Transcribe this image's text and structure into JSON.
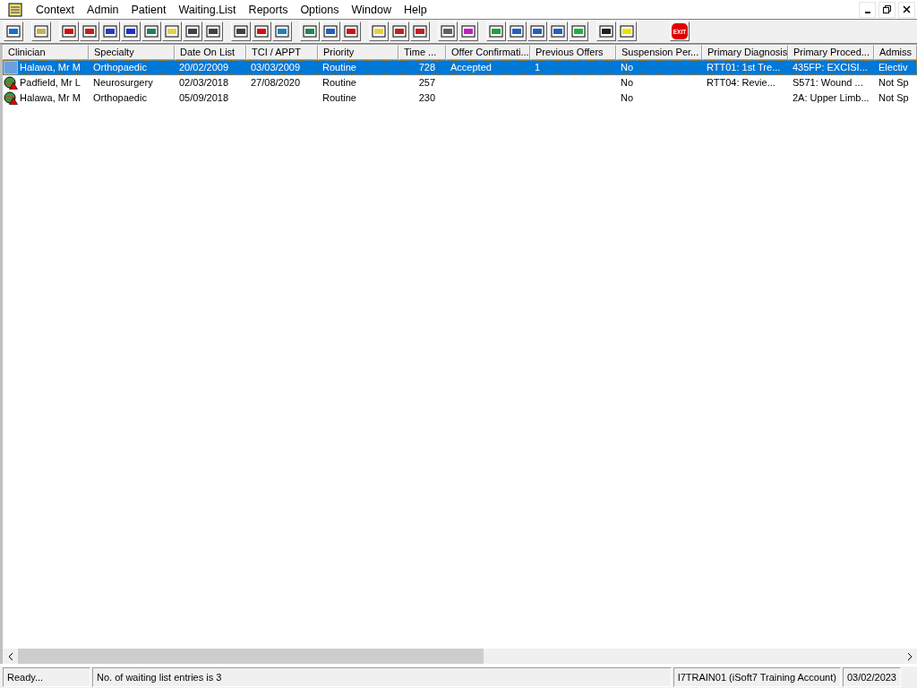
{
  "menu": [
    "Context",
    "Admin",
    "Patient",
    "Waiting.List",
    "Reports",
    "Options",
    "Window",
    "Help"
  ],
  "toolbar": {
    "exit_label": "EXIT"
  },
  "table": {
    "columns": [
      "Clinician",
      "Specialty",
      "Date On List",
      "TCI / APPT",
      "Priority",
      "Time ...",
      "Offer Confirmati...",
      "Previous Offers",
      "Suspension Per...",
      "Primary Diagnosis",
      "Primary Proced...",
      "Admiss"
    ],
    "rows": [
      {
        "selected": true,
        "warning": false,
        "cells": [
          "Halawa, Mr M",
          "Orthopaedic",
          "20/02/2009",
          "03/03/2009",
          "Routine",
          "728",
          "Accepted",
          "1",
          "No",
          "RTT01: 1st Tre...",
          "435FP: EXCISI...",
          "Electiv"
        ]
      },
      {
        "selected": false,
        "warning": true,
        "cells": [
          "Padfield, Mr L",
          "Neurosurgery",
          "02/03/2018",
          "27/08/2020",
          "Routine",
          "257",
          "",
          "",
          "No",
          "RTT04: Revie...",
          "S571: Wound ...",
          "Not Sp"
        ]
      },
      {
        "selected": false,
        "warning": true,
        "cells": [
          "Halawa, Mr M",
          "Orthopaedic",
          "05/09/2018",
          "",
          "Routine",
          "230",
          "",
          "",
          "No",
          "",
          "2A: Upper Limb...",
          "Not Sp"
        ]
      }
    ]
  },
  "status_bar": [
    "Ready...",
    "No. of waiting list entries is 3",
    "I7TRAIN01 (iSoft7 Training Account)",
    "03/02/2023"
  ]
}
